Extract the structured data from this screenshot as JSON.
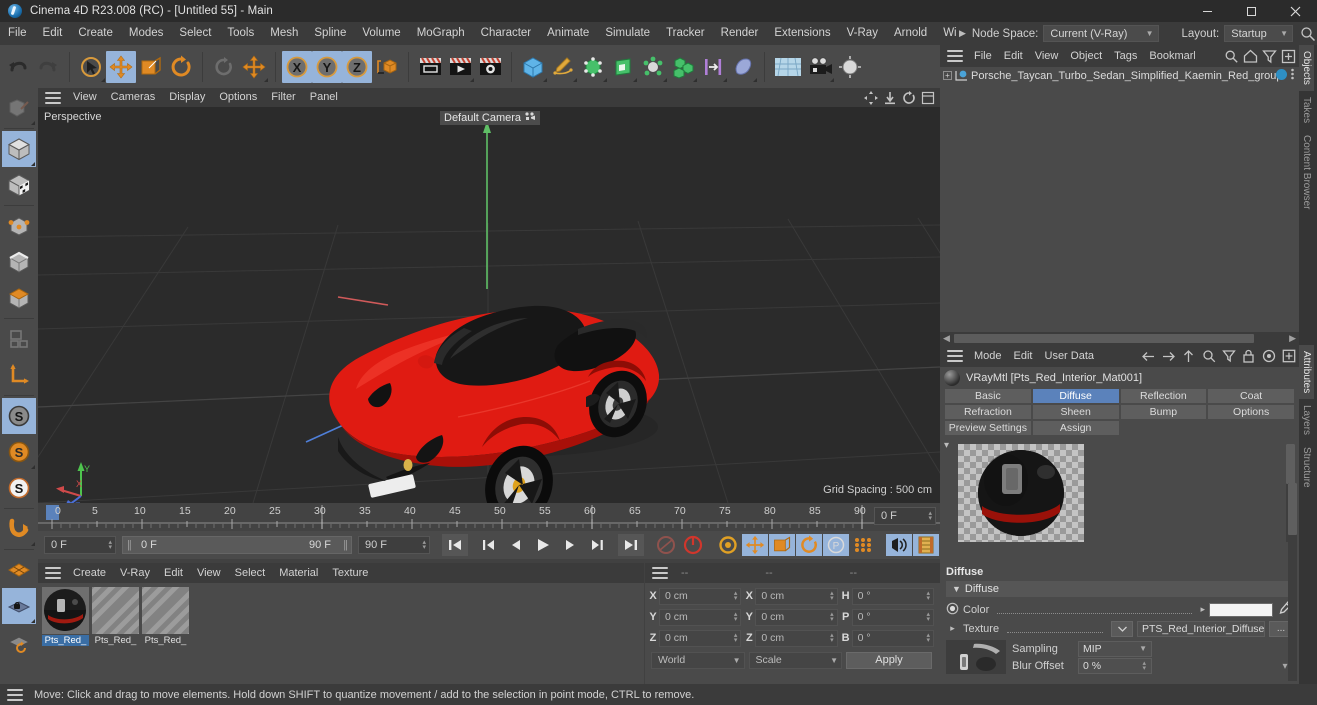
{
  "window": {
    "title": "Cinema 4D R23.008 (RC) - [Untitled 55] - Main",
    "logo_icon": "cinema4d-logo-icon",
    "minimize_label": "Minimize",
    "maximize_label": "Maximize",
    "close_label": "Close"
  },
  "main_menu": {
    "items": [
      "File",
      "Edit",
      "Create",
      "Modes",
      "Select",
      "Tools",
      "Mesh",
      "Spline",
      "Volume",
      "MoGraph",
      "Character",
      "Animate",
      "Simulate",
      "Tracker",
      "Render",
      "Extensions",
      "V-Ray",
      "Arnold",
      "Wind"
    ],
    "node_space_label": "Node Space:",
    "node_space_value": "Current (V-Ray)",
    "layout_label": "Layout:",
    "layout_value": "Startup",
    "search_icon": "search-icon",
    "overflow_icon": "menu-overflow-arrow-icon"
  },
  "toolbar": {
    "groups": [
      {
        "buttons": [
          {
            "name": "undo-button",
            "icon": "undo-arrow-icon",
            "active": false
          },
          {
            "name": "redo-button",
            "icon": "redo-arrow-icon",
            "active": false,
            "disabled": true
          }
        ]
      },
      {
        "buttons": [
          {
            "name": "live-selection-tool",
            "icon": "cursor-select-icon",
            "active": false,
            "corner": true
          },
          {
            "name": "move-tool",
            "icon": "move-arrows-icon",
            "active": true
          },
          {
            "name": "scale-tool",
            "icon": "scale-box-icon",
            "active": false
          },
          {
            "name": "rotate-tool",
            "icon": "rotate-arc-icon",
            "active": false
          }
        ]
      },
      {
        "buttons": [
          {
            "name": "last-used-tool",
            "icon": "rotate-ghost-icon",
            "active": false,
            "disabled": true
          },
          {
            "name": "dynamic-place-tool",
            "icon": "move-arrows-icon",
            "active": false,
            "corner": true
          }
        ]
      },
      {
        "buttons": [
          {
            "name": "x-axis-lock",
            "icon": "axis-x-icon",
            "active": true
          },
          {
            "name": "y-axis-lock",
            "icon": "axis-y-icon",
            "active": true
          },
          {
            "name": "z-axis-lock",
            "icon": "axis-z-icon",
            "active": true
          },
          {
            "name": "world-object-coordinates",
            "icon": "world-axis-cube-icon",
            "active": false
          }
        ]
      },
      {
        "buttons": [
          {
            "name": "render-view-button",
            "icon": "render-clapper-icon",
            "active": false
          },
          {
            "name": "render-to-picture-viewer-button",
            "icon": "render-play-clapper-icon",
            "active": false
          },
          {
            "name": "render-settings-button",
            "icon": "render-gear-clapper-icon",
            "active": false
          }
        ]
      },
      {
        "buttons": [
          {
            "name": "add-cube-button",
            "icon": "cube-blue-icon",
            "active": false,
            "corner": true
          },
          {
            "name": "add-spline-button",
            "icon": "pen-spline-icon",
            "active": false,
            "corner": true
          },
          {
            "name": "generators-button",
            "icon": "green-cube-points-icon",
            "active": false,
            "corner": true
          },
          {
            "name": "deformers-button",
            "icon": "bend-cube-icon",
            "active": false,
            "corner": true
          },
          {
            "name": "scene-objects-button",
            "icon": "environment-node-icon",
            "active": false,
            "corner": true
          },
          {
            "name": "mograph-button",
            "icon": "cloner-cubes-icon",
            "active": false,
            "corner": true
          },
          {
            "name": "field-objects-button",
            "icon": "field-bars-icon",
            "active": false,
            "corner": true
          },
          {
            "name": "deformer-blob-button",
            "icon": "blob-deformer-icon",
            "active": false,
            "corner": true
          }
        ]
      },
      {
        "buttons": [
          {
            "name": "scene-environment-button",
            "icon": "sky-grid-icon",
            "active": false
          },
          {
            "name": "camera-button",
            "icon": "camera-icon",
            "active": false,
            "corner": true
          },
          {
            "name": "light-button",
            "icon": "light-bulb-icon",
            "active": false,
            "corner": true
          }
        ]
      }
    ]
  },
  "left_toolbar": {
    "buttons": [
      {
        "name": "make-editable-button",
        "icon": "make-editable-icon",
        "active": false,
        "disabled": true,
        "corner": true
      },
      {
        "name": "model-mode-button",
        "icon": "model-cube-icon",
        "active": true,
        "corner": true
      },
      {
        "name": "texture-mode-button",
        "icon": "texture-checker-cube-icon",
        "active": false
      },
      {
        "name": "points-mode-button",
        "icon": "points-cube-icon",
        "active": false
      },
      {
        "name": "edges-mode-button",
        "icon": "edges-cube-icon",
        "active": false
      },
      {
        "name": "polygons-mode-button",
        "icon": "polygons-cube-icon",
        "active": false
      },
      {
        "name": "workplane-mode-button",
        "icon": "workplane-icon",
        "active": false,
        "disabled": true
      },
      {
        "name": "axis-modify-button",
        "icon": "axis-l-icon",
        "active": false
      },
      {
        "name": "enable-snapping-button",
        "icon": "snap-s-grey-icon",
        "active": true
      },
      {
        "name": "snap-settings-button",
        "icon": "snap-s-orange-icon",
        "active": false,
        "corner": true
      },
      {
        "name": "quantize-button",
        "icon": "snap-s-white-icon",
        "active": false
      },
      {
        "name": "magnet-tool-button",
        "icon": "magnet-icon",
        "active": false,
        "corner": true
      },
      {
        "name": "workplane-grid-button",
        "icon": "grid-plane-orange-icon",
        "active": false
      },
      {
        "name": "lock-workplane-button",
        "icon": "grid-plane-lock-icon",
        "active": true,
        "corner": true
      },
      {
        "name": "planar-workplane-button",
        "icon": "grid-plane-rotate-icon",
        "active": false
      }
    ]
  },
  "viewport": {
    "menu_items": [
      "View",
      "Cameras",
      "Display",
      "Options",
      "Filter",
      "Panel"
    ],
    "burger_icon": "hamburger-menu-icon",
    "right_icons": [
      "pan-view-icon",
      "dolly-view-icon",
      "rotate-view-icon",
      "maximize-view-icon"
    ],
    "label": "Perspective",
    "camera_label": "Default Camera",
    "camera_icon": "camera-dots-icon",
    "grid_spacing": "Grid Spacing : 500 cm",
    "axis_gizmo": {
      "x": "X",
      "y": "Y",
      "z": "Z"
    },
    "model_name": "Porsche Taycan Turbo Sedan (red)"
  },
  "timeline": {
    "ticks": [
      "0",
      "5",
      "10",
      "15",
      "20",
      "25",
      "30",
      "35",
      "40",
      "45",
      "50",
      "55",
      "60",
      "65",
      "70",
      "75",
      "80",
      "85",
      "90"
    ],
    "current_frame_marker": "0",
    "right_frame_field": "0 F"
  },
  "transport": {
    "current_frame": "0 F",
    "range_start": "0 F",
    "range_end": "90 F",
    "end_frame": "90 F",
    "buttons": [
      {
        "name": "go-to-start-button",
        "icon": "skip-start-icon",
        "active": false
      },
      {
        "name": "go-to-previous-key-button",
        "icon": "prev-key-icon",
        "active": false
      },
      {
        "name": "step-back-button",
        "icon": "step-back-icon",
        "active": false
      },
      {
        "name": "play-button",
        "icon": "play-icon",
        "active": false
      },
      {
        "name": "step-forward-button",
        "icon": "step-forward-icon",
        "active": false
      },
      {
        "name": "go-to-next-key-button",
        "icon": "next-key-icon",
        "active": false
      },
      {
        "name": "go-to-end-button",
        "icon": "skip-end-icon",
        "active": false
      },
      {
        "name": "record-active-objects-button",
        "icon": "record-dot-icon",
        "active": false
      },
      {
        "name": "autokeying-button",
        "icon": "autokey-circle-icon",
        "active": false
      },
      {
        "name": "keyframe-selection-button",
        "icon": "keyframe-gear-icon",
        "active": false
      },
      {
        "name": "position-key-button",
        "icon": "position-move-icon",
        "active": true
      },
      {
        "name": "scale-key-button",
        "icon": "scale-key-icon",
        "active": true
      },
      {
        "name": "rotation-key-button",
        "icon": "rotation-key-icon",
        "active": true
      },
      {
        "name": "param-key-button",
        "icon": "param-p-icon",
        "active": true
      },
      {
        "name": "point-level-animation-button",
        "icon": "pla-dots-icon",
        "active": false
      },
      {
        "name": "sound-button",
        "icon": "speaker-icon",
        "active": true
      },
      {
        "name": "timeline-toggle-button",
        "icon": "film-strip-icon",
        "active": true
      }
    ]
  },
  "material_manager": {
    "menu_items": [
      "Create",
      "V-Ray",
      "Edit",
      "View",
      "Select",
      "Material",
      "Texture"
    ],
    "burger_icon": "hamburger-menu-icon",
    "materials": [
      {
        "name": "Pts_Red_",
        "selected": true,
        "thumb": "sphere-dark-preview"
      },
      {
        "name": "Pts_Red_",
        "selected": false,
        "thumb": "striped-placeholder"
      },
      {
        "name": "Pts_Red_",
        "selected": false,
        "thumb": "striped-placeholder"
      }
    ]
  },
  "coordinates": {
    "burger_icon": "hamburger-menu-icon",
    "column_headers": [
      "--",
      "--",
      "--"
    ],
    "rows": [
      {
        "axis1": "X",
        "value1": "0 cm",
        "axis2": "X",
        "value2": "0 cm",
        "axis3": "H",
        "value3": "0 °"
      },
      {
        "axis1": "Y",
        "value1": "0 cm",
        "axis2": "Y",
        "value2": "0 cm",
        "axis3": "P",
        "value3": "0 °"
      },
      {
        "axis1": "Z",
        "value1": "0 cm",
        "axis2": "Z",
        "value2": "0 cm",
        "axis3": "B",
        "value3": "0 °"
      }
    ],
    "system_value": "World",
    "mode_value": "Scale",
    "apply_label": "Apply"
  },
  "object_manager": {
    "menu_items": [
      "File",
      "Edit",
      "View",
      "Object",
      "Tags",
      "Bookmarks"
    ],
    "burger_icon": "hamburger-menu-icon",
    "icons": [
      "search-icon",
      "home-icon",
      "filter-funnel-icon",
      "add-panel-icon"
    ],
    "objects": [
      {
        "name": "Porsche_Taycan_Turbo_Sedan_Simplified_Kaemin_Red_group",
        "icon": "null-object-icon",
        "expandable": true
      }
    ]
  },
  "attribute_manager": {
    "menu_items": [
      "Mode",
      "Edit",
      "User Data"
    ],
    "burger_icon": "hamburger-menu-icon",
    "icons": [
      "back-arrow-icon",
      "forward-arrow-icon",
      "up-arrow-icon",
      "search-icon",
      "filter-funnel-icon",
      "lock-icon",
      "target-icon",
      "add-panel-icon"
    ],
    "title": "VRayMtl [Pts_Red_Interior_Mat001]",
    "material_icon": "material-sphere-icon",
    "tabs": [
      [
        "Basic",
        "Diffuse",
        "Reflection",
        "Coat"
      ],
      [
        "Refraction",
        "Sheen",
        "Bump",
        "Options"
      ],
      [
        "Preview Settings",
        "Assign",
        "",
        ""
      ]
    ],
    "active_tab": "Diffuse",
    "section_title": "Diffuse",
    "group_title": "Diffuse",
    "properties": {
      "color_label": "Color",
      "color_value": "#f3f3f3",
      "color_icon": "color-radio-icon",
      "eyedropper_icon": "eyedropper-icon",
      "texture_label": "Texture",
      "texture_value": "PTS_Red_Interior_Diffuse.pn",
      "texture_browse_label": "...",
      "sampling_label": "Sampling",
      "sampling_value": "MIP",
      "blur_offset_label": "Blur Offset",
      "blur_offset_value": "0 %"
    }
  },
  "right_tabs": {
    "top": [
      {
        "label": "Objects",
        "active": true
      },
      {
        "label": "Takes",
        "active": false
      },
      {
        "label": "Content Browser",
        "active": false
      }
    ],
    "bottom": [
      {
        "label": "Attributes",
        "active": true
      },
      {
        "label": "Layers",
        "active": false
      },
      {
        "label": "Structure",
        "active": false
      }
    ]
  },
  "statusbar": {
    "burger_icon": "hamburger-menu-icon",
    "text": "Move: Click and drag to move elements. Hold down SHIFT to quantize movement / add to the selection in point mode, CTRL to remove."
  },
  "colors": {
    "accent_blue": "#5b82bb",
    "active_tool": "#96b4da",
    "orange": "#e08a24",
    "panel_bg": "#4a4a4a",
    "menu_bg": "#3b3b3b",
    "viewport_bg": "#2b2b2b",
    "car_red": "#e01b12"
  }
}
